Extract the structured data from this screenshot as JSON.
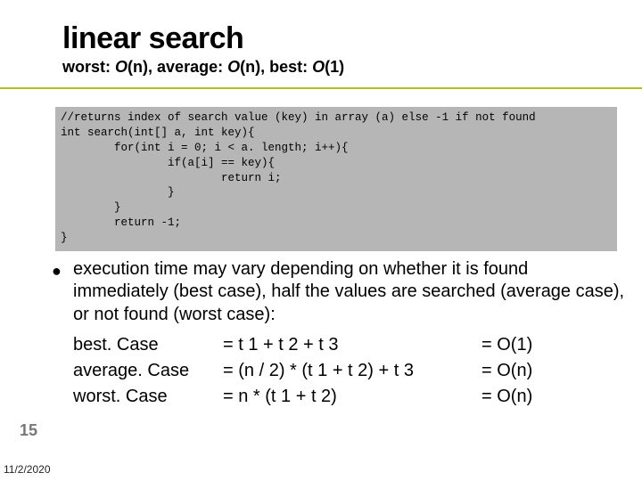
{
  "title": "linear search",
  "subtitle": {
    "worst_label": "worst: ",
    "worst_O": "O",
    "worst_arg": "(n), ",
    "avg_label": "average: ",
    "avg_O": "O",
    "avg_arg": "(n), ",
    "best_label": "best: ",
    "best_O": "O",
    "best_arg": "(1)"
  },
  "code": "//returns index of search value (key) in array (a) else -1 if not found\nint search(int[] a, int key){\n        for(int i = 0; i < a. length; i++){\n                if(a[i] == key){\n                        return i;\n                }\n        }\n        return -1;\n}",
  "body": "execution time may vary depending on whether it is found immediately (best case), half the values are searched (average case), or not found (worst case):",
  "cases": [
    {
      "label": "best. Case",
      "expr": "= t 1 + t 2 + t 3",
      "big": "= O(1)"
    },
    {
      "label": "average. Case",
      "expr": "= (n / 2) * (t 1 + t 2) + t 3",
      "big": "= O(n)"
    },
    {
      "label": "worst. Case",
      "expr": "= n * (t 1 + t 2)",
      "big": "= O(n)"
    }
  ],
  "page_number": "15",
  "date": "11/2/2020",
  "bullet_glyph": "●"
}
